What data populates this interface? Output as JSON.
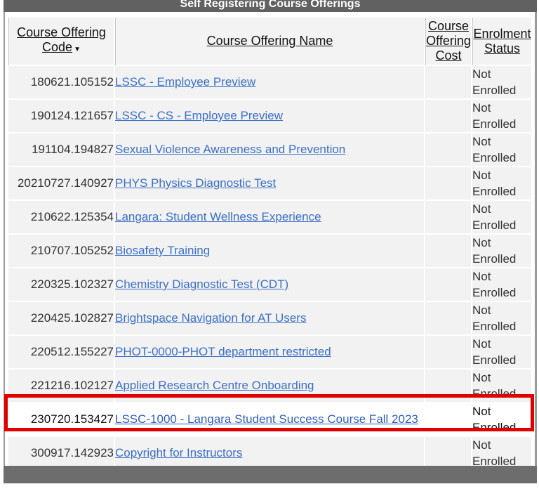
{
  "panel": {
    "title": "Self Registering Course Offerings"
  },
  "table": {
    "headers": {
      "code": "Course Offering Code",
      "name": "Course Offering Name",
      "cost": "Course Offering Cost",
      "status": "Enrolment Status"
    },
    "sort_indicator": "▼",
    "rows": [
      {
        "code": "180621.105152",
        "name": "LSSC - Employee Preview",
        "cost": "",
        "status": "Not Enrolled"
      },
      {
        "code": "190124.121657",
        "name": "LSSC - CS - Employee Preview",
        "cost": "",
        "status": "Not Enrolled"
      },
      {
        "code": "191104.194827",
        "name": "Sexual Violence Awareness and Prevention",
        "cost": "",
        "status": "Not Enrolled"
      },
      {
        "code": "20210727.140927",
        "name": "PHYS Physics Diagnostic Test",
        "cost": "",
        "status": "Not Enrolled"
      },
      {
        "code": "210622.125354",
        "name": "Langara: Student Wellness Experience",
        "cost": "",
        "status": "Not Enrolled"
      },
      {
        "code": "210707.105252",
        "name": "Biosafety Training",
        "cost": "",
        "status": "Not Enrolled"
      },
      {
        "code": "220325.102327",
        "name": "Chemistry Diagnostic Test (CDT)",
        "cost": "",
        "status": "Not Enrolled"
      },
      {
        "code": "220425.102827",
        "name": "Brightspace Navigation for AT Users",
        "cost": "",
        "status": "Not Enrolled"
      },
      {
        "code": "220512.155227",
        "name": "PHOT-0000-PHOT department restricted",
        "cost": "",
        "status": "Not Enrolled"
      },
      {
        "code": "221216.102127",
        "name": "Applied Research Centre Onboarding",
        "cost": "",
        "status": "Not Enrolled"
      },
      {
        "code": "230720.153427",
        "name": "LSSC-1000 - Langara Student Success Course Fall 2023",
        "cost": "",
        "status": "Not Enrolled",
        "highlighted": true
      },
      {
        "code": "300917.142923",
        "name": "Copyright for Instructors",
        "cost": "",
        "status": "Not Enrolled"
      }
    ]
  },
  "colors": {
    "title_bar": "#616161",
    "link": "#3b6fc9",
    "highlight_border": "#e00000"
  }
}
